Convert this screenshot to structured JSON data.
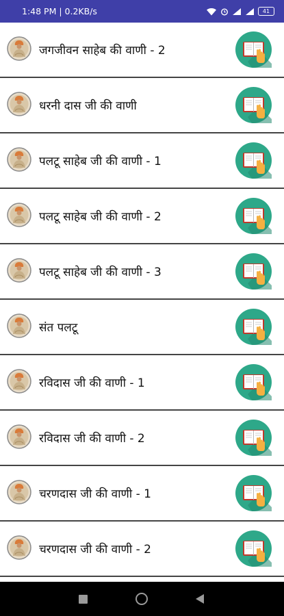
{
  "status_bar": {
    "time_speed": "1:48 PM | 0.2KB/s",
    "battery": "41"
  },
  "items": [
    {
      "title": "जगजीवन साहेब की वाणी - 2"
    },
    {
      "title": "धरनी दास जी की वाणी"
    },
    {
      "title": "पलटू साहेब जी की वाणी - 1"
    },
    {
      "title": "पलटू साहेब जी की वाणी - 2"
    },
    {
      "title": "पलटू साहेब जी की वाणी - 3"
    },
    {
      "title": "संत पलटू"
    },
    {
      "title": "रविदास जी की वाणी - 1"
    },
    {
      "title": "रविदास जी की वाणी - 2"
    },
    {
      "title": "चरणदास जी की वाणी - 1"
    },
    {
      "title": "चरणदास जी की वाणी - 2"
    }
  ],
  "icons": {
    "avatar": "saint-portrait-icon",
    "read": "open-book-hand-icon"
  },
  "colors": {
    "status_bar": "#3f3fa8",
    "read_button": "#2ea889",
    "divider": "#444444",
    "nav_bar": "#000000"
  }
}
